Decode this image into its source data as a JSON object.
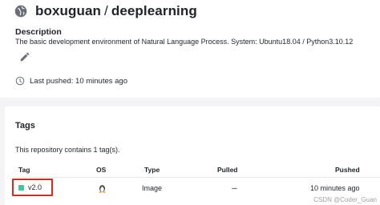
{
  "repo": {
    "namespace": "boxuguan",
    "separator": "/",
    "name": "deeplearning",
    "description_label": "Description",
    "description": "The basic development environment of Natural Language Process. System: Ubuntu18.04 / Python3.10.12",
    "last_pushed": "Last pushed: 10 minutes ago"
  },
  "tags": {
    "title": "Tags",
    "summary": "This repository contains 1 tag(s).",
    "columns": [
      "Tag",
      "OS",
      "Type",
      "Pulled",
      "Pushed"
    ],
    "rows": [
      {
        "tag": "v2.0",
        "os_icon": "linux-tux-icon",
        "type": "Image",
        "pulled": "---",
        "pushed": "10 minutes ago"
      }
    ]
  },
  "watermark": "CSDN @Coder_Guan",
  "colors": {
    "highlight_border": "#e8221b",
    "tag_dot": "#47c3a3"
  },
  "icons": {
    "repo": "globe-icon",
    "edit": "pencil-icon",
    "history": "clock-icon"
  }
}
